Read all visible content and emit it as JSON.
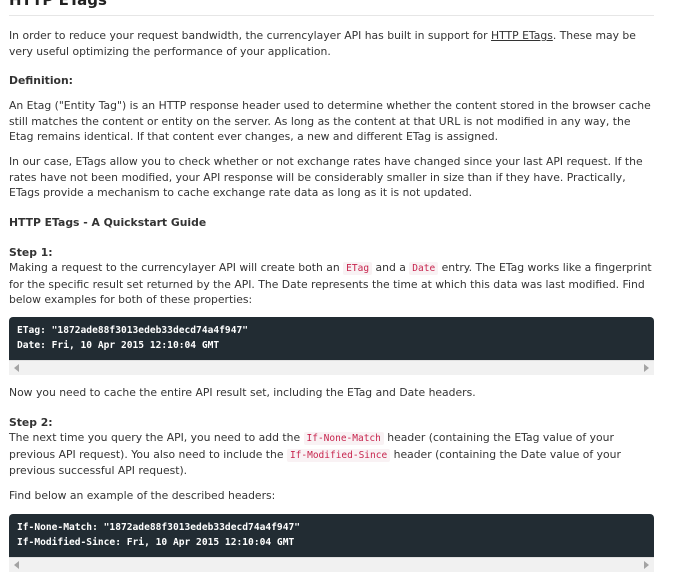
{
  "title": "HTTP ETags",
  "intro": {
    "before": "In order to reduce your request bandwidth, the currencylayer API has built in support for ",
    "link": "HTTP ETags",
    "after": ". These may be very useful optimizing the performance of your application."
  },
  "definition_heading": "Definition:",
  "definition_text": "An Etag (\"Entity Tag\") is an HTTP response header used to determine whether the content stored in the browser cache still matches the content or entity on the server. As long as the content at that URL is not modified in any way, the Etag remains identical. If that content ever changes, a new and different ETag is assigned.",
  "case_text": "In our case, ETags allow you to check whether or not exchange rates have changed since your last API request. If the rates have not been modified, your API response will be considerably smaller in size than if they have. Practically, ETags provide a mechanism to cache exchange rate data as long as it is not updated.",
  "quickstart_heading": "HTTP ETags - A Quickstart Guide",
  "step1": {
    "heading": "Step 1:",
    "t1": "Making a request to the currencylayer API will create both an ",
    "c1": "ETag",
    "t2": " and a ",
    "c2": "Date",
    "t3": " entry. The ETag works like a fingerprint for the specific result set returned by the API. The Date represents the time at which this data was last modified. Find below examples for both of these properties:"
  },
  "code1": [
    "ETag: \"1872ade88f3013edeb33decd74a4f947\"",
    "Date: Fri, 10 Apr 2015 12:10:04 GMT"
  ],
  "cache_text": "Now you need to cache the entire API result set, including the ETag and Date headers.",
  "step2": {
    "heading": "Step 2:",
    "t1": "The next time you query the API, you need to add the ",
    "c1": "If-None-Match",
    "t2": " header (containing the ETag value of your previous API request). You also need to include the ",
    "c2": "If-Modified-Since",
    "t3": " header (containing the Date value of your previous successful API request)."
  },
  "find_text": "Find below an example of the described headers:",
  "code2": [
    "If-None-Match: \"1872ade88f3013edeb33decd74a4f947\"",
    "If-Modified-Since: Fri, 10 Apr 2015 12:10:04 GMT"
  ]
}
